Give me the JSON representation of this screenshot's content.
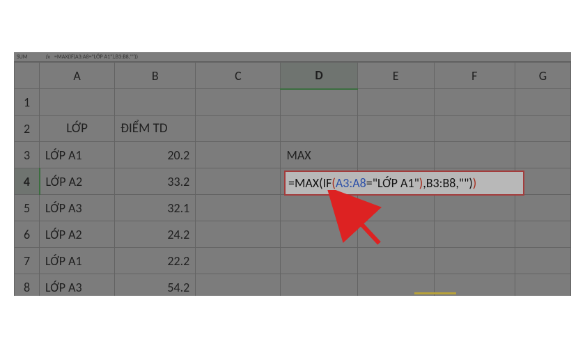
{
  "formula_bar": {
    "name_box": "SUM",
    "fx_label": "fx",
    "text": "=MAX(IF(A3:A8=\"LỚP A1\"),B3:B8,\"\"))"
  },
  "columns": [
    "A",
    "B",
    "C",
    "D",
    "E",
    "F",
    "G"
  ],
  "rows": [
    "1",
    "2",
    "3",
    "4",
    "5",
    "6",
    "7",
    "8"
  ],
  "active": {
    "col": "D",
    "row": "4"
  },
  "headers": {
    "A2": "LỚP",
    "B2": "ĐIỂM TD"
  },
  "data": {
    "A3": "LỚP A1",
    "B3": "20.2",
    "A4": "LỚP A2",
    "B4": "33.2",
    "A5": "LỚP A3",
    "B5": "32.1",
    "A6": "LỚP A2",
    "B6": "24.2",
    "A7": "LỚP A1",
    "B7": "22.2",
    "A8": "LỚP A3",
    "B8": "54.2",
    "D3": "MAX"
  },
  "formula_parts": {
    "p1": "=MAX(IF",
    "p2": "(",
    "p3": "A3:A8",
    "p4": "=\"LỚP A1\"",
    "p5": ")",
    "p6": ",B3:B8,\"\"",
    "p7": ")",
    "p8": ")"
  },
  "chart_data": {
    "type": "table",
    "title": "",
    "columns": [
      "LỚP",
      "ĐIỂM TD"
    ],
    "rows": [
      [
        "LỚP A1",
        20.2
      ],
      [
        "LỚP A2",
        33.2
      ],
      [
        "LỚP A3",
        32.1
      ],
      [
        "LỚP A2",
        24.2
      ],
      [
        "LỚP A1",
        22.2
      ],
      [
        "LỚP A3",
        54.2
      ]
    ],
    "formula": "=MAX(IF(A3:A8=\"LỚP A1\"),B3:B8,\"\"))"
  }
}
